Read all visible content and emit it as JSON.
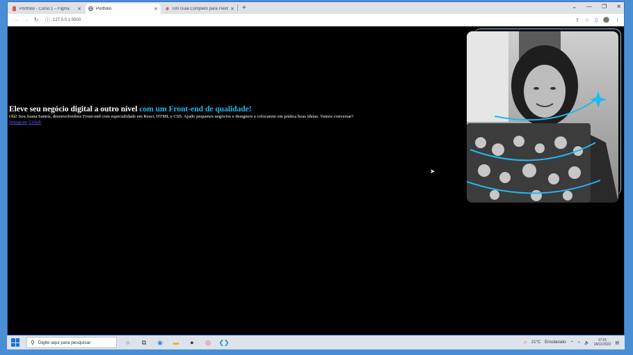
{
  "browser": {
    "tabs": [
      {
        "label": "Portfolio - Curso 1 – Figma",
        "icon": "figma-icon",
        "active": false
      },
      {
        "label": "Portfolio",
        "icon": "globe-icon",
        "active": true
      },
      {
        "label": "Um Guia Completo para Flexbox",
        "icon": "css-tricks-icon",
        "active": false
      }
    ],
    "address": "127.0.0.1:5500"
  },
  "hero": {
    "title_main": "Eleve seu negócio digital a outro nível ",
    "title_accent": "com um Front-end de qualidade!",
    "description": "Olá! Sou Joana Santos, desenvolvedora Front-end com especialidade em React, HTML e CSS. Ajudo pequenos negócios e designers a colocarem em prática boas ideias. Vamos conversar?",
    "link_instagram": "Instagram",
    "link_github": "Github",
    "accent_color": "#22b8f0"
  },
  "taskbar": {
    "search_placeholder": "Digite aqui para pesquisar",
    "weather_temp": "21°C",
    "weather_text": "Ensolarado",
    "time": "17:01",
    "date": "18/11/2022"
  }
}
